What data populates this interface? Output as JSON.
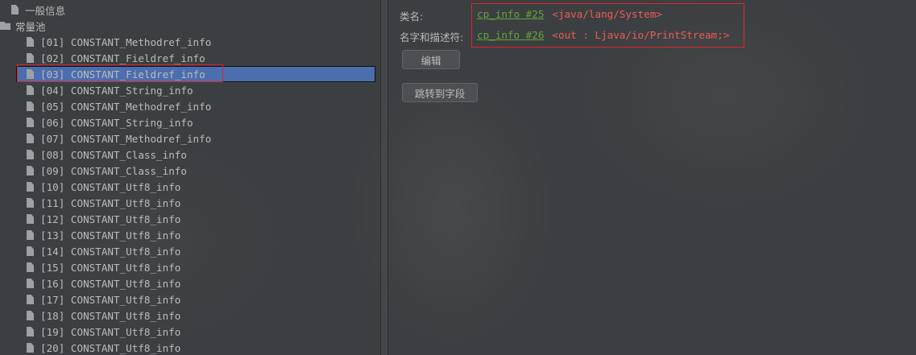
{
  "tree": {
    "root_items": [
      {
        "label": "一般信息",
        "icon": "file-icon"
      },
      {
        "label": "常量池",
        "icon": "folder-icon"
      }
    ],
    "pool_items": [
      "[01] CONSTANT_Methodref_info",
      "[02] CONSTANT_Fieldref_info",
      "[03] CONSTANT_Fieldref_info",
      "[04] CONSTANT_String_info",
      "[05] CONSTANT_Methodref_info",
      "[06] CONSTANT_String_info",
      "[07] CONSTANT_Methodref_info",
      "[08] CONSTANT_Class_info",
      "[09] CONSTANT_Class_info",
      "[10] CONSTANT_Utf8_info",
      "[11] CONSTANT_Utf8_info",
      "[12] CONSTANT_Utf8_info",
      "[13] CONSTANT_Utf8_info",
      "[14] CONSTANT_Utf8_info",
      "[15] CONSTANT_Utf8_info",
      "[16] CONSTANT_Utf8_info",
      "[17] CONSTANT_Utf8_info",
      "[18] CONSTANT_Utf8_info",
      "[19] CONSTANT_Utf8_info",
      "[20] CONSTANT_Utf8_info"
    ],
    "selected_index": 2
  },
  "detail": {
    "class_label": "类名:",
    "class_ref": "cp_info #25",
    "class_desc": "<java/lang/System>",
    "name_type_label": "名字和描述符:",
    "name_type_ref": "cp_info #26",
    "name_type_desc": "<out : Ljava/io/PrintStream;>",
    "edit_button": "编辑",
    "goto_button": "跳转到字段"
  },
  "colors": {
    "background": "#3c3f41",
    "text": "#bbbbbb",
    "selection": "#4b6eaf",
    "link_green": "#62a53b",
    "desc_red": "#ef5a58",
    "highlight_frame": "#e0242a"
  }
}
